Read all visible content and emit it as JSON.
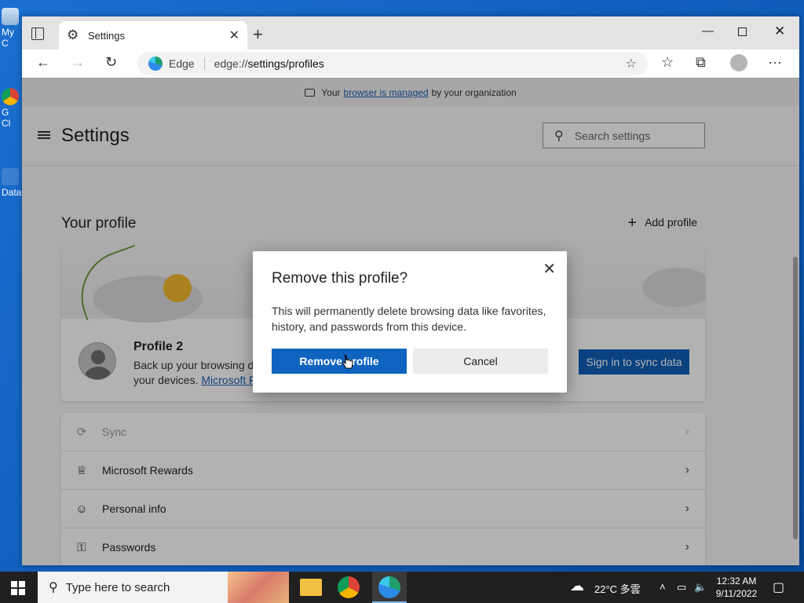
{
  "desktop": {
    "icons": [
      {
        "label": "My C"
      },
      {
        "label": "G\nCl"
      },
      {
        "label": "Data"
      }
    ]
  },
  "browser": {
    "tab_title": "Settings",
    "address_brand": "Edge",
    "address_scheme": "edge://",
    "address_path": "settings/profiles",
    "infobar": {
      "prefix": "Your",
      "link": "browser is managed",
      "suffix": "by your organization"
    }
  },
  "settings": {
    "title": "Settings",
    "search_placeholder": "Search settings",
    "section_title": "Your profile",
    "add_profile_label": "Add profile",
    "profile": {
      "name": "Profile 2",
      "desc_part1": "Back up your browsing d",
      "desc_part2": "your devices.",
      "desc_link": "Microsoft F",
      "sync_button": "Sign in to sync data"
    },
    "items": [
      {
        "label": "Sync"
      },
      {
        "label": "Microsoft Rewards"
      },
      {
        "label": "Personal info"
      },
      {
        "label": "Passwords"
      }
    ]
  },
  "dialog": {
    "title": "Remove this profile?",
    "text": "This will permanently delete browsing data like favorites, history, and passwords from this device.",
    "primary": "Remove profile",
    "secondary": "Cancel"
  },
  "taskbar": {
    "search_placeholder": "Type here to search",
    "weather": "22°C 多雲",
    "time": "12:32 AM",
    "date": "9/11/2022"
  }
}
